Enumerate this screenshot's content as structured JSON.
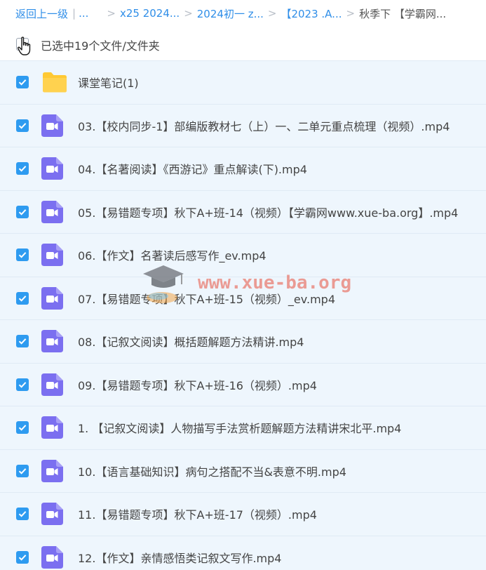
{
  "breadcrumb": {
    "back_label": "返回上一级",
    "ellipsis": "...",
    "items": [
      "x25 2024...",
      "2024初一 z...",
      "【2023 .A...",
      "秋季下 【学霸网..."
    ]
  },
  "selection": {
    "status_text": "已选中19个文件/文件夹"
  },
  "files": [
    {
      "type": "folder",
      "name": "课堂笔记(1)"
    },
    {
      "type": "video",
      "name": "03.【校内同步-1】部编版教材七（上）一、二单元重点梳理（视频）.mp4"
    },
    {
      "type": "video",
      "name": "04.【名著阅读】《西游记》重点解读(下).mp4"
    },
    {
      "type": "video",
      "name": "05.【易错题专项】秋下A+班-14（视频）【学霸网www.xue-ba.org】.mp4"
    },
    {
      "type": "video",
      "name": "06.【作文】名著读后感写作_ev.mp4"
    },
    {
      "type": "video",
      "name": "07.【易错题专项】秋下A+班-15（视频）_ev.mp4"
    },
    {
      "type": "video",
      "name": "08.【记叙文阅读】概括题解题方法精讲.mp4"
    },
    {
      "type": "video",
      "name": "09.【易错题专项】秋下A+班-16（视频）.mp4"
    },
    {
      "type": "video",
      "name": "1. 【记叙文阅读】人物描写手法赏析题解题方法精讲宋北平.mp4"
    },
    {
      "type": "video",
      "name": "10.【语言基础知识】病句之搭配不当&表意不明.mp4"
    },
    {
      "type": "video",
      "name": "11.【易错题专项】秋下A+班-17（视频）.mp4"
    },
    {
      "type": "video",
      "name": "12.【作文】亲情感悟类记叙文写作.mp4"
    }
  ],
  "watermark": {
    "text": "www.xue-ba.org"
  },
  "colors": {
    "link": "#2f8ee8",
    "checkbox": "#2e9bf0",
    "row_bg": "#eef6fd",
    "video_icon": "#7b6ff0",
    "folder_icon": "#ffc933"
  },
  "icons": {
    "folder": "folder-icon",
    "video": "video-file-icon",
    "check": "check-icon",
    "cursor": "hand-cursor-icon"
  }
}
